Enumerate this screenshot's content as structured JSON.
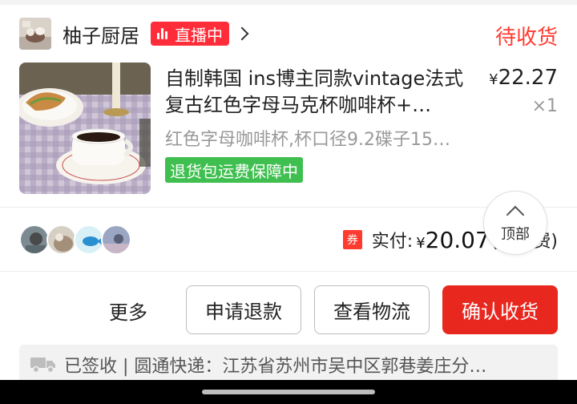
{
  "shop": {
    "name": "柚子厨居",
    "live_label": "直播中",
    "status": "待收货"
  },
  "product": {
    "title": "自制韩国 ins博主同款vintage法式复古红色字母马克杯咖啡杯+…",
    "price_symbol": "¥",
    "price": "22.27",
    "quantity": "×1",
    "spec": "红色字母咖啡杯,杯口径9.2碟子15…",
    "guarantee": "退货包运费保障中"
  },
  "payment": {
    "coupon_label": "券",
    "paid_label": "实付:",
    "symbol": "¥",
    "amount": "20.07",
    "extra": "(免运费)"
  },
  "floating": {
    "top_label": "顶部"
  },
  "actions": {
    "more": "更多",
    "refund": "申请退款",
    "logistics": "查看物流",
    "confirm": "确认收货"
  },
  "logistics": {
    "text": "已签收 | 圆通快递：江苏省苏州市吴中区郭巷姜庄分…"
  },
  "colors": {
    "accent_red": "#e8271f",
    "status_red": "#ff3b30",
    "guarantee_green": "#3fbf4f"
  }
}
